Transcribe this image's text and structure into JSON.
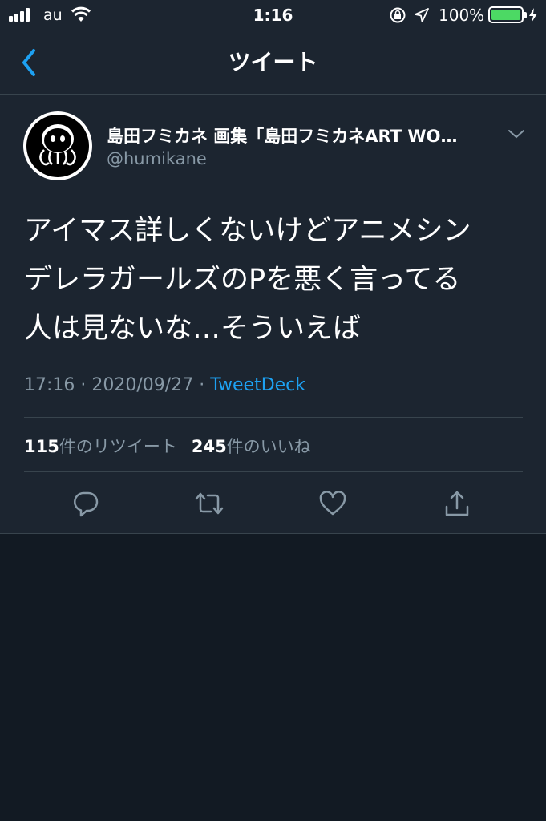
{
  "status_bar": {
    "carrier": "au",
    "time": "1:16",
    "battery": "100%"
  },
  "nav": {
    "title": "ツイート"
  },
  "tweet": {
    "display_name": "島田フミカネ 画集「島田フミカネART WO…",
    "handle": "@humikane",
    "lines": [
      "アイマス詳しくないけどアニメシン",
      "デレラガールズのPを悪く言ってる",
      "人は見ないな…そういえば"
    ],
    "time": "17:16",
    "separator": "·",
    "date": "2020/09/27",
    "source": "TweetDeck",
    "retweets": "115",
    "retweets_label": "件のリツイート",
    "likes": "245",
    "likes_label": "件のいいね"
  },
  "colors": {
    "background": "#121a23",
    "panel": "#1c2530",
    "accent": "#1da1f2",
    "muted": "#8899a6",
    "battery": "#4cd964"
  },
  "icons": [
    "signal-icon",
    "wifi-icon",
    "lock-rotation-icon",
    "location-icon",
    "battery-icon",
    "charging-icon",
    "back-icon",
    "chevron-down-icon",
    "reply-icon",
    "retweet-icon",
    "like-icon",
    "share-icon"
  ]
}
